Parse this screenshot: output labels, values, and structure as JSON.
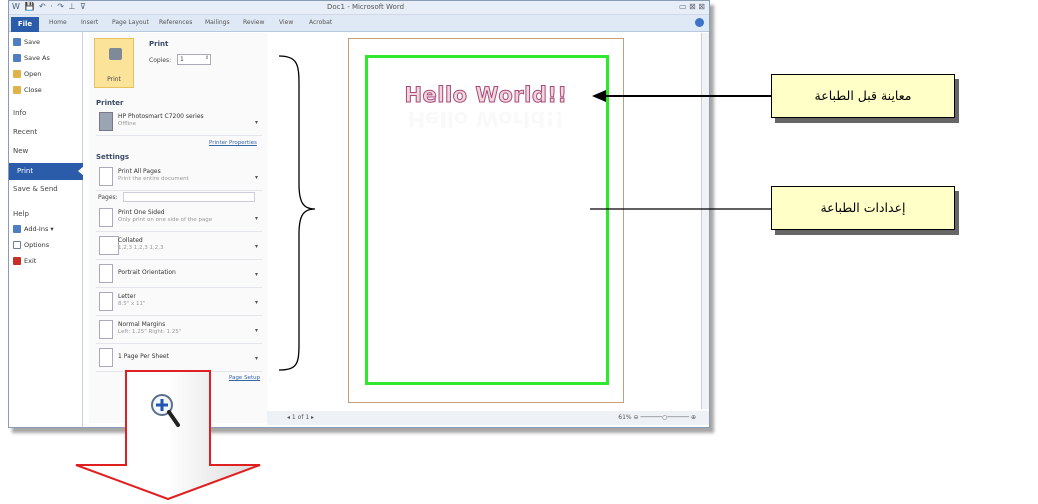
{
  "window": {
    "title": "Doc1 - Microsoft Word",
    "qat_symbols": "W 💾 ↶ · ↷ ⊥ ⊽",
    "controls": "▭ ⊠ ⊠"
  },
  "ribbon": {
    "file_tab": "File",
    "tabs": [
      "Home",
      "Insert",
      "Page Layout",
      "References",
      "Mailings",
      "Review",
      "View",
      "Acrobat"
    ]
  },
  "backstage": {
    "items": [
      {
        "label": "Save",
        "icon": "save-icon"
      },
      {
        "label": "Save As",
        "icon": "save-as-icon"
      },
      {
        "label": "Open",
        "icon": "folder-open-icon"
      },
      {
        "label": "Close",
        "icon": "folder-close-icon"
      }
    ],
    "nav": [
      "Info",
      "Recent",
      "New"
    ],
    "print": "Print",
    "save_send": "Save & Send",
    "help": "Help",
    "addins": "Add-Ins ▾",
    "options": "Options",
    "exit": "Exit"
  },
  "settings": {
    "print_heading": "Print",
    "copies_label": "Copies:",
    "copies_value": "1",
    "print_button": "Print",
    "printer_heading": "Printer",
    "printer_name": "HP Photosmart C7200 series",
    "printer_status": "Offline",
    "printer_properties": "Printer Properties",
    "settings_heading": "Settings",
    "range": {
      "t1": "Print All Pages",
      "t2": "Print the entire document"
    },
    "pages_label": "Pages:",
    "sides": {
      "t1": "Print One Sided",
      "t2": "Only print on one side of the page"
    },
    "collated": {
      "t1": "Collated",
      "t2": "1,2,3   1,2,3   1,2,3"
    },
    "orientation": {
      "t1": "Portrait Orientation",
      "t2": ""
    },
    "paper": {
      "t1": "Letter",
      "t2": "8.5\" x 11\""
    },
    "margins": {
      "t1": "Normal Margins",
      "t2": "Left: 1.25\"   Right: 1.25\""
    },
    "pages_per_sheet": {
      "t1": "1 Page Per Sheet",
      "t2": ""
    },
    "page_setup": "Page Setup"
  },
  "preview": {
    "text": "Hello World!!",
    "page_nav": "◂  1   of 1  ▸",
    "zoom": "61%  ⊖ ──────○────── ⊕"
  },
  "callouts": {
    "preview_label": "معاينة قبل الطباعة",
    "settings_label": "إعدادات الطباعة"
  },
  "colors": {
    "accent": "#2a5caa",
    "print_button": "#fbe49a",
    "page_border": "#2ee82e",
    "callout_bg": "#ffffc8",
    "arrow_red": "#e02020"
  }
}
